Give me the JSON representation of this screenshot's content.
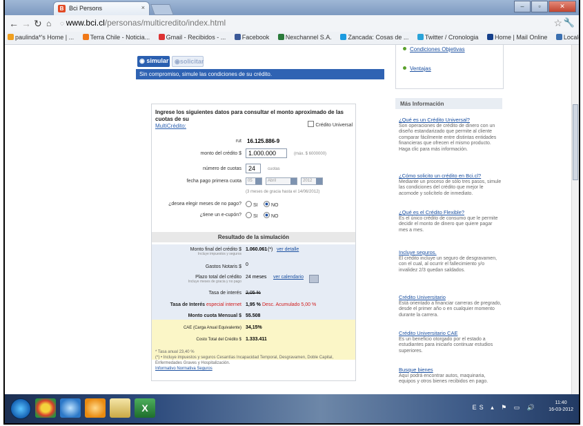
{
  "browser": {
    "tab_title": "Bci Persons",
    "url_host": "www.bci.cl",
    "url_path": "/personas/multicredito/index.html",
    "bookmarks": [
      {
        "label": "paulinda*'s Home | ...",
        "color": "#f0a020"
      },
      {
        "label": "Terra Chile - Noticia...",
        "color": "#f07818"
      },
      {
        "label": "Gmail - Recibidos - ...",
        "color": "#d33"
      },
      {
        "label": "Facebook",
        "color": "#3b5998"
      },
      {
        "label": "Nexchannel S.A.",
        "color": "#2a7a3a"
      },
      {
        "label": "Zancada: Cosas de ...",
        "color": "#1c9be0"
      },
      {
        "label": "Twitter / Cronologia",
        "color": "#2aa3d8"
      },
      {
        "label": "Home | Mail Online",
        "color": "#153f8a"
      },
      {
        "label": "Locales | topfashion",
        "color": "#3a6fb0"
      }
    ]
  },
  "simulator": {
    "btn_simular": "simular",
    "btn_solicitar": "solicitar",
    "banner": "Sin compromiso, simule las condiciones de su crédito.",
    "intro": "Ingrese los siguientes datos para consultar el monto aproximado de las cuotas de su",
    "intro_link": "MultiCrédito:",
    "credito_universal": "Crédito Universal",
    "rut_label": "rut",
    "rut_value": "16.125.886-9",
    "monto_label": "monto del crédito $",
    "monto_value": "1.000.000",
    "monto_hint": "(máx. $ 6000000)",
    "cuotas_label": "número de cuotas",
    "cuotas_value": "24",
    "cuotas_unit": "cuotas",
    "fecha_label": "fecha pago primera cuota",
    "fecha_day": "05",
    "fecha_month": "Abril",
    "fecha_year": "2012",
    "fecha_hint": "(3 meses de gracia hasta el 14/06/2012)",
    "no_pago_label": "¿desea elegir meses de no pago?",
    "ecupon_label": "¿tiene un e-cupón?",
    "si": "SI",
    "no": "NO"
  },
  "result": {
    "title": "Resultado de la simulación",
    "monto_final_label": "Monto final del crédito $",
    "monto_final_sub": "Incluye impuestos y seguros",
    "monto_final_value": "1.060.061",
    "monto_final_mark": "(*)",
    "ver_detalle": "ver detalle",
    "gastos_label": "Gastos Notaris $",
    "gastos_value": "0",
    "plazo_label": "Plazo total del crédito",
    "plazo_sub": "Incluye meses de gracia y no pago",
    "plazo_value": "24 meses",
    "ver_calendario": "ver calendario",
    "tasa_label": "Tasa de interés",
    "tasa_value": "2,05 %",
    "tasa_especial_label_a": "Tasa de Interés",
    "tasa_especial_label_b": "especial internet",
    "tasa_especial_value": "1,95 %",
    "desc": "Desc. Acumulado 5,00 %",
    "cuota_label": "Monto cuota Mensual $",
    "cuota_value": "55.508",
    "cae_label": "CAE (Carga Anual Equivalente)",
    "cae_value": "34,15%",
    "costo_label": "Costo Total del Crédito $",
    "costo_value": "1.333.411",
    "note1": "* Tasa anual 23,40 %",
    "note2": "(*) • Incluye impuestos y seguros Cesantías Incapacidad Temporal, Desgravamen, Doble Capital, Enfermedades Graves y Hospitalización.",
    "note_link": "Informativo Normativa Seguros"
  },
  "sidebar": {
    "top_links": [
      "Condiciones Objetivas",
      "Ventajas"
    ],
    "mas_info": "Más Información",
    "items": [
      {
        "title": "¿Qué es un Crédito Universal?",
        "text": "Son operaciones de crédito de dinero con un diseño estandarizado que permite al cliente comparar fácilmente entre distintas entidades financieras que ofrecen el mismo producto. Haga clic para más información."
      },
      {
        "title": "¿Cómo solicito un crédito en Bci.cl?",
        "text": "Mediante un proceso de sólo tres pasos, simule las condiciones del crédito que mejor le acomode y solicítelo de inmediato."
      },
      {
        "title": "¿Qué es el Crédito Flexible?",
        "text": "Es el único crédito de consumo que le permite decidir el monto de dinero que quiere pagar mes a mes."
      },
      {
        "title": "Incluye seguros.",
        "text": "El crédito incluye un seguro de desgravamen, con el cual, al ocurrir el fallecimiento y/o invalidez 2/3 quedan saldados."
      },
      {
        "title": "Crédito Universitario",
        "text": "Está orientado a financiar carreras de pregrado, desde el primer año o en cualquier momento durante la carrera."
      },
      {
        "title": "Crédito Universitario CAE",
        "text": "Es un beneficio otorgado por el estado a estudiantes para iniciarlo continuar estudios superiores."
      },
      {
        "title": "Busque bienes",
        "text": "Aquí podrá encontrar autos, maquinaria, equipos y otros bienes recibidos en pago."
      }
    ]
  },
  "taskbar": {
    "lang": "ES",
    "time": "11:40",
    "date": "16-03-2012"
  }
}
